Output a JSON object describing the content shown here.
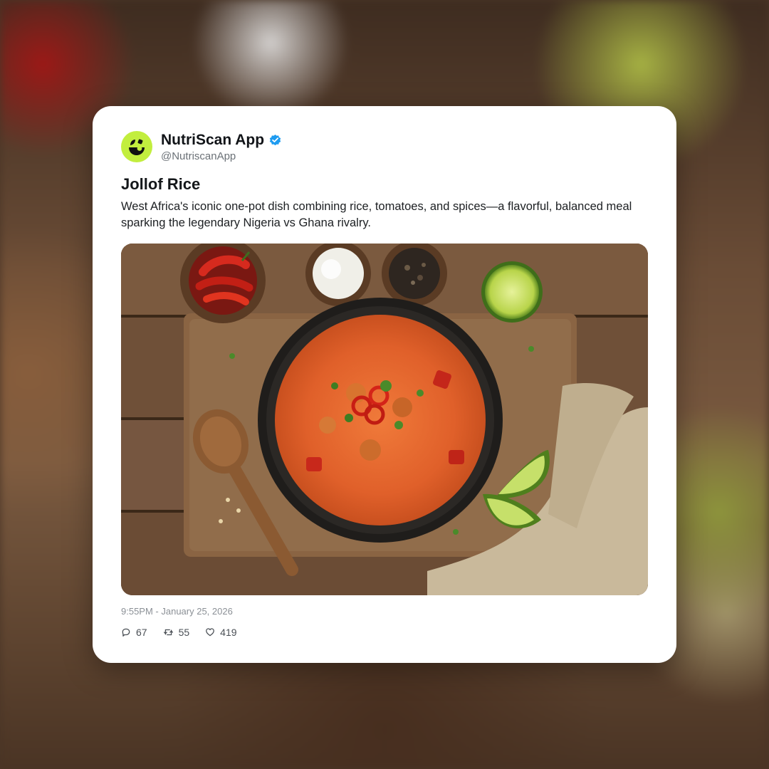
{
  "post": {
    "author": {
      "name": "NutriScan App",
      "handle": "@NutriscanApp",
      "verified": true,
      "avatar_icon": "nutriscan-logo-icon",
      "avatar_color": "#c2ee3e"
    },
    "title": "Jollof Rice",
    "description": "West Africa's iconic one-pot dish combining rice, tomatoes, and spices—a flavorful, balanced meal sparking the legendary Nigeria vs Ghana rivalry.",
    "image": {
      "subject": "jollof-rice-photo"
    },
    "timestamp": "9:55PM - January 25, 2026",
    "stats": {
      "replies": "67",
      "reposts": "55",
      "likes": "419"
    }
  },
  "colors": {
    "verified_badge": "#1d9bf0",
    "card_background": "#ffffff"
  }
}
